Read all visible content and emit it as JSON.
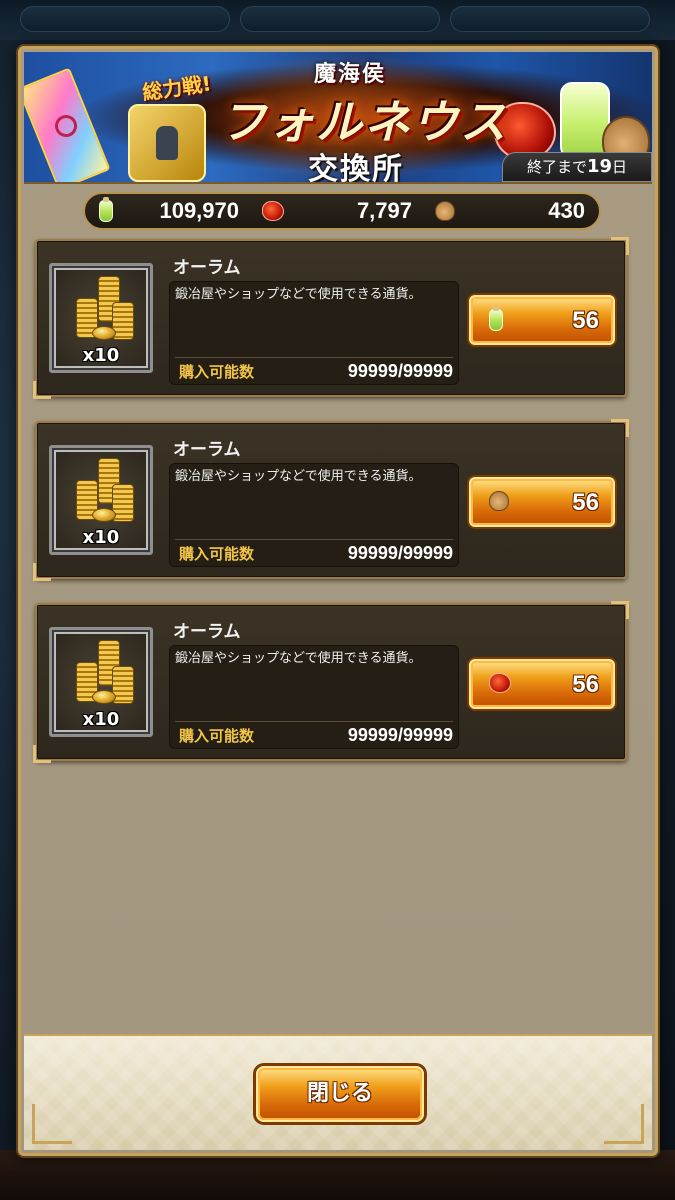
{
  "banner": {
    "tagline": "総力戦!",
    "title_small": "魔海侯",
    "title_big": "フォルネウス",
    "subtitle": "交換所",
    "days_prefix": "終了まで",
    "days_value": "19",
    "days_suffix": "日"
  },
  "currencies": [
    {
      "icon": "bottle-icon",
      "value": "109,970"
    },
    {
      "icon": "red-stone-icon",
      "value": "7,797"
    },
    {
      "icon": "pouch-icon",
      "value": "430"
    }
  ],
  "items": [
    {
      "name": "オーラム",
      "quantity": "x10",
      "description": "鍛冶屋やショップなどで使用できる通貨。",
      "limit_label": "購入可能数",
      "limit_value": "99999/99999",
      "cost_icon": "bottle-icon",
      "cost": "56"
    },
    {
      "name": "オーラム",
      "quantity": "x10",
      "description": "鍛冶屋やショップなどで使用できる通貨。",
      "limit_label": "購入可能数",
      "limit_value": "99999/99999",
      "cost_icon": "pouch-icon",
      "cost": "56"
    },
    {
      "name": "オーラム",
      "quantity": "x10",
      "description": "鍛冶屋やショップなどで使用できる通貨。",
      "limit_label": "購入可能数",
      "limit_value": "99999/99999",
      "cost_icon": "red-stone-icon",
      "cost": "56"
    }
  ],
  "footer": {
    "close_label": "閉じる"
  },
  "colors": {
    "accent_gold": "#c9a35a",
    "button_orange": "#f0a01a",
    "limit_label": "#f2c448"
  }
}
